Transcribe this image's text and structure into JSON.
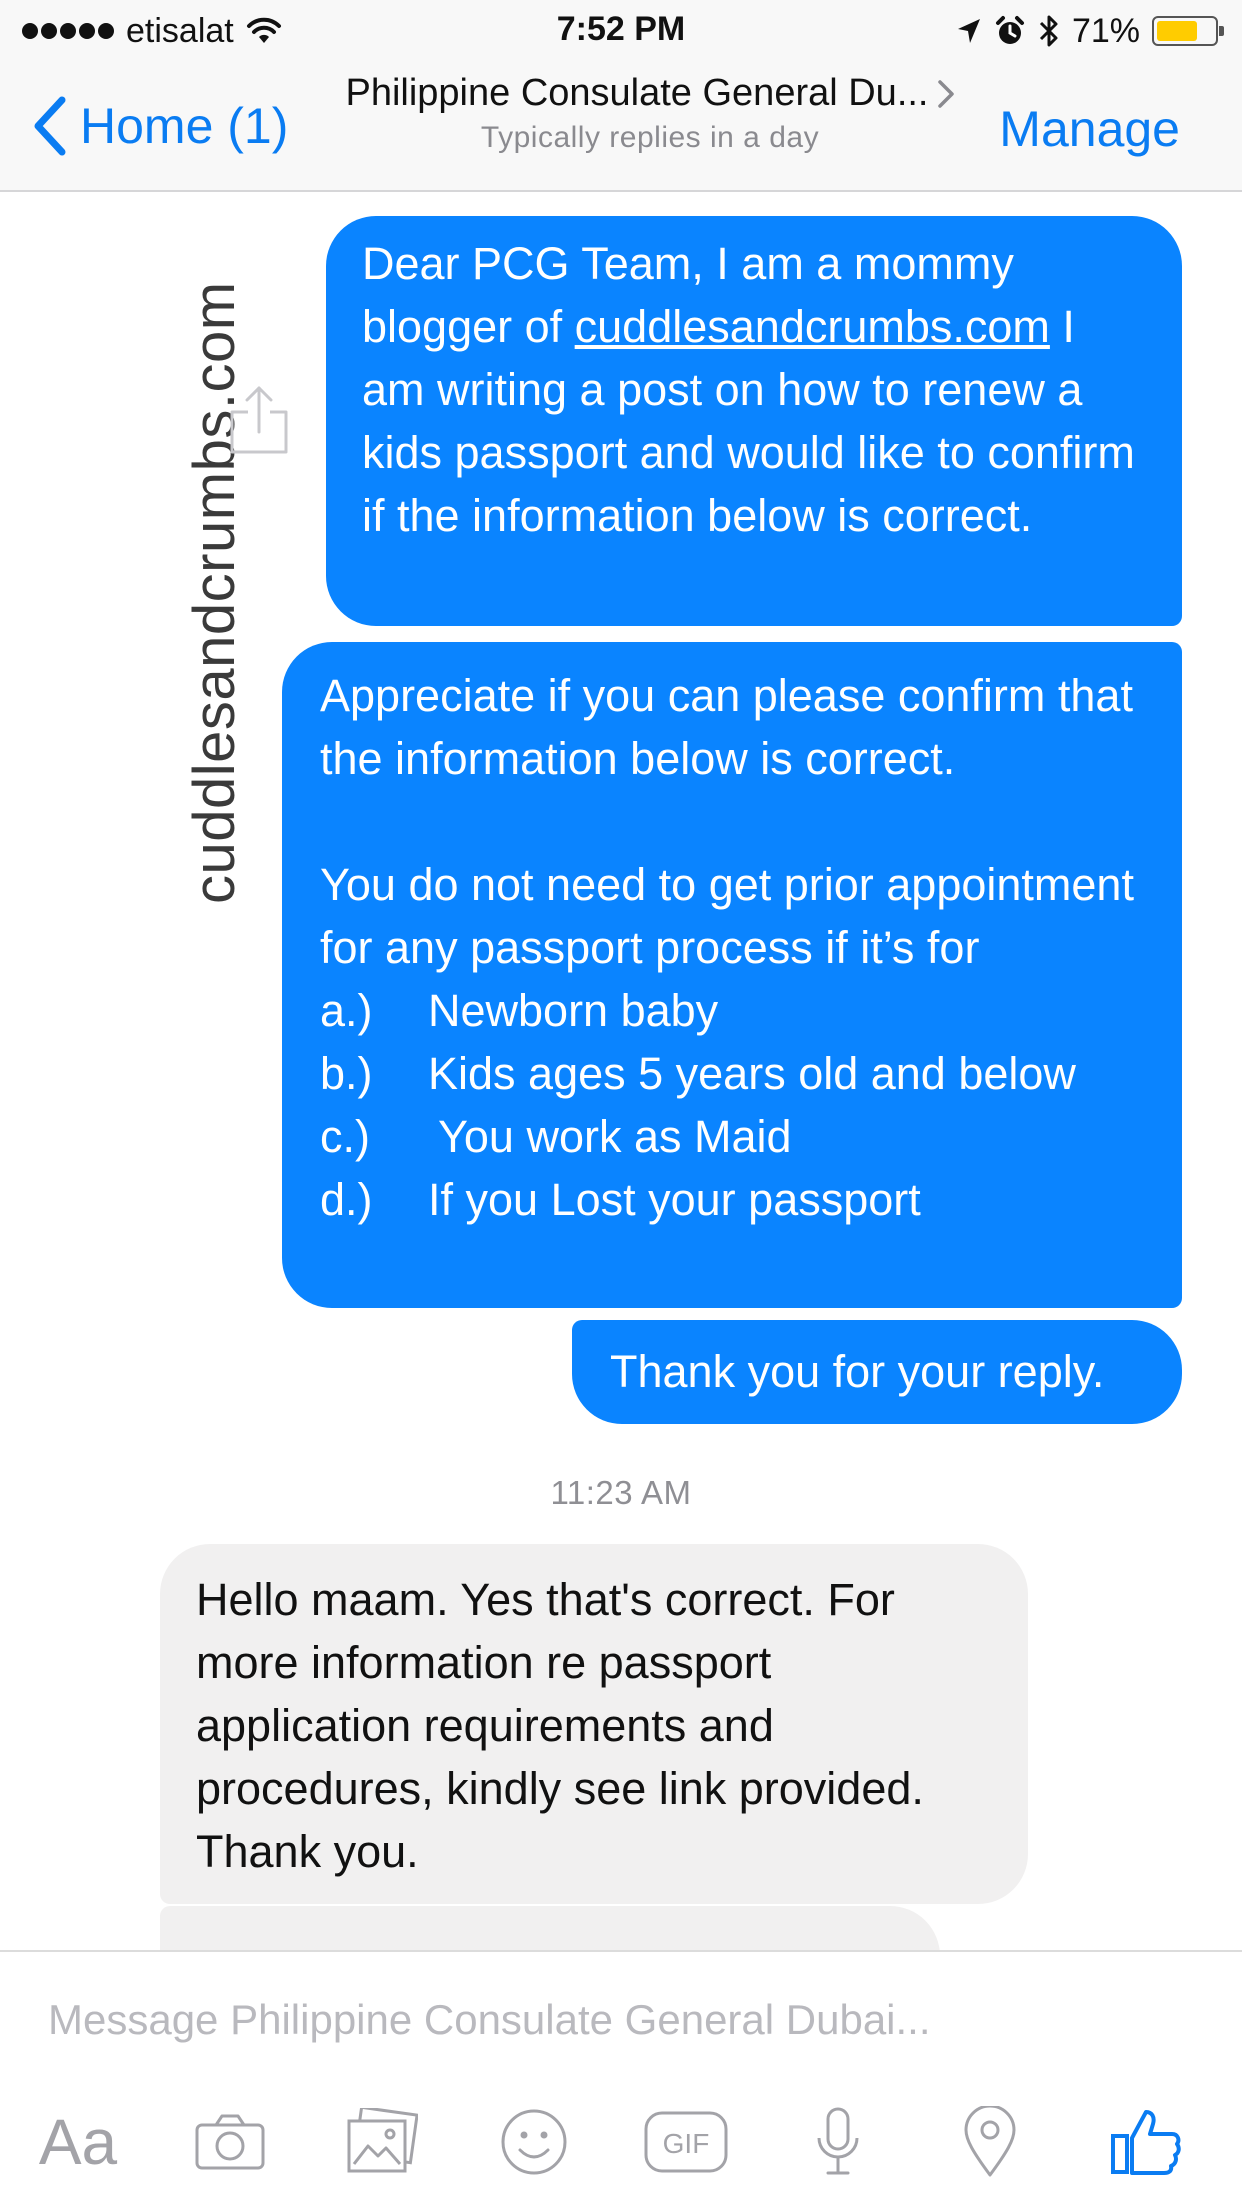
{
  "status_bar": {
    "carrier": "etisalat",
    "time": "7:52 PM",
    "battery_percent": "71%",
    "battery_level": 0.71,
    "battery_color": "#ffcc00",
    "icons": [
      "signal-dots",
      "wifi-icon",
      "location-arrow-icon",
      "alarm-icon",
      "bluetooth-icon",
      "battery-icon"
    ]
  },
  "nav": {
    "back_label": "Home (1)",
    "title": "Philippine Consulate General Du...",
    "subtitle": "Typically replies in a day",
    "manage_label": "Manage",
    "accent_color": "#0a7cf2"
  },
  "conversation": {
    "watermark": "cuddlesandcrumbs.com",
    "timestamp": "11:23 AM",
    "message1": {
      "pre": "Dear PCG Team, I am a mommy blogger of ",
      "link": "cuddlesandcrumbs.com",
      "post": " I am writing a post on how to renew a kids passport and would like to confirm if the information below is correct."
    },
    "message2": {
      "para1": "Appreciate if you can please confirm that the information below is correct.",
      "para2": "You do not need to get prior appointment for any passport process if it’s for",
      "items": [
        {
          "marker": "a.)",
          "text": "Newborn baby"
        },
        {
          "marker": "b.)",
          "text": "Kids ages 5 years old and below"
        },
        {
          "marker": "c.)",
          "text": "You work as Maid"
        },
        {
          "marker": "d.)",
          "text": "If you Lost your passport"
        }
      ]
    },
    "message3": "Thank you for your reply.",
    "reply1": "Hello maam. Yes that's correct. For more information re passport application requirements and procedures, kindly see link provided. Thank you.",
    "sent_bubble_color": "#0a84ff",
    "received_bubble_color": "#f1f0f0"
  },
  "composer": {
    "placeholder": "Message Philippine Consulate General Dubai...",
    "aa_label": "Aa",
    "gif_label": "GIF",
    "tools": [
      "aa-icon",
      "camera-icon",
      "photo-icon",
      "emoji-icon",
      "gif-icon",
      "microphone-icon",
      "location-pin-icon",
      "like-thumb-icon"
    ]
  }
}
